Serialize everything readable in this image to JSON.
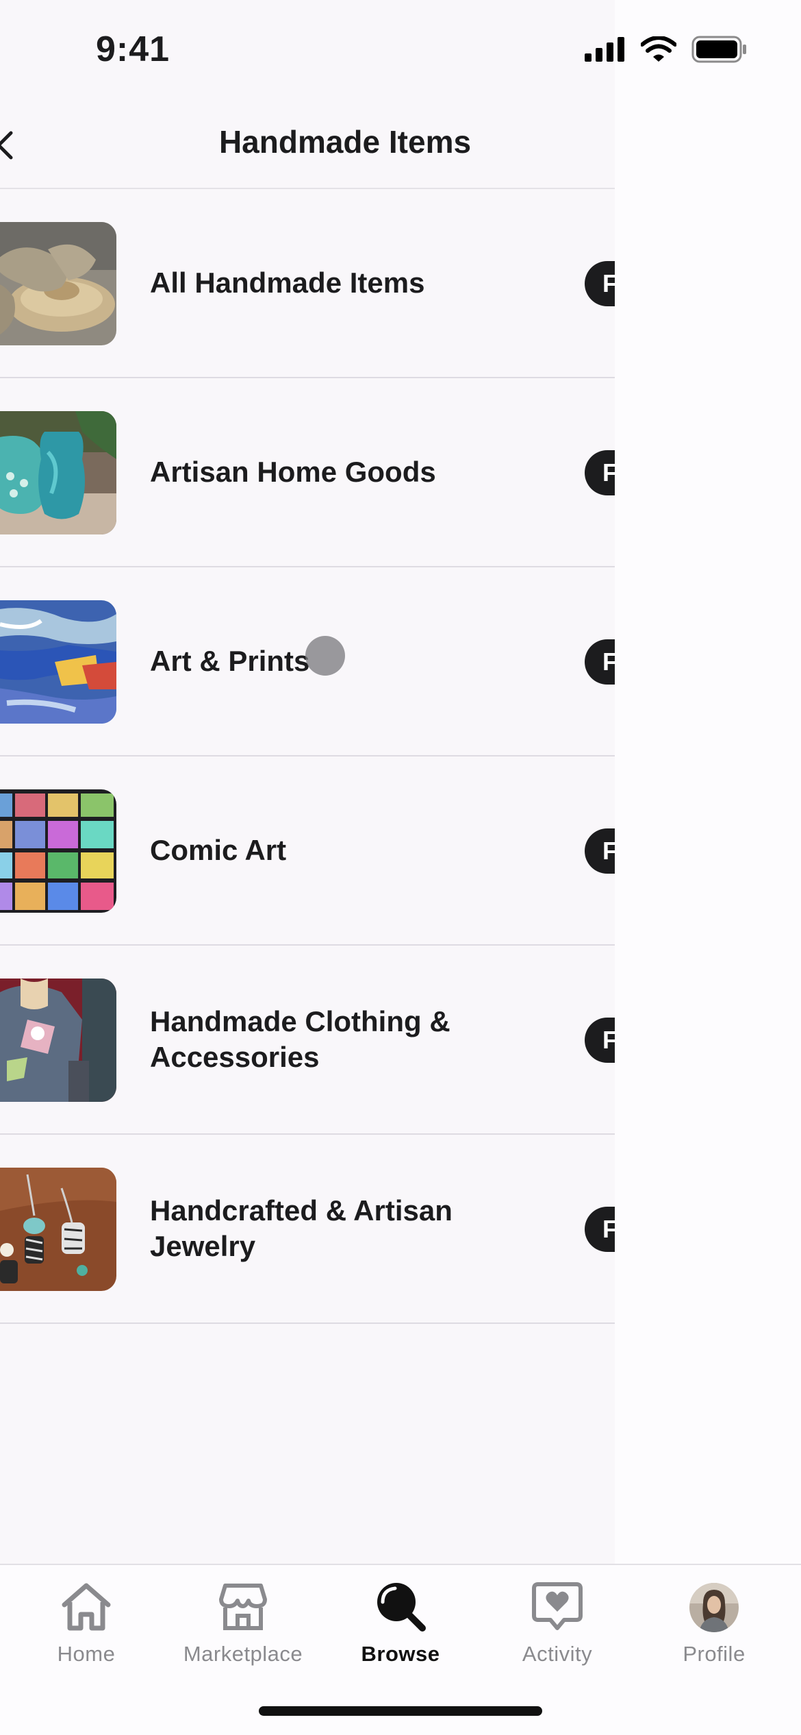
{
  "status_bar": {
    "time": "9:41"
  },
  "header": {
    "title": "Handmade Items"
  },
  "categories": [
    {
      "label": "All Handmade Items",
      "button": "F",
      "thumb": "pottery-wheel-image"
    },
    {
      "label": "Artisan Home Goods",
      "button": "F",
      "thumb": "ceramic-vases-image"
    },
    {
      "label": "Art & Prints",
      "button": "F",
      "thumb": "abstract-painting-image"
    },
    {
      "label": "Comic Art",
      "button": "F",
      "thumb": "comic-panels-image"
    },
    {
      "label": "Handmade Clothing & Accessories",
      "button": "F",
      "thumb": "sweater-image"
    },
    {
      "label": "Handcrafted & Artisan Jewelry",
      "button": "F",
      "thumb": "jewelry-image"
    }
  ],
  "tab_bar": {
    "tabs": [
      {
        "label": "Home",
        "icon": "house-icon",
        "active": false
      },
      {
        "label": "Marketplace",
        "icon": "storefront-icon",
        "active": false
      },
      {
        "label": "Browse",
        "icon": "magnifier-icon",
        "active": true
      },
      {
        "label": "Activity",
        "icon": "heart-bubble-icon",
        "active": false
      },
      {
        "label": "Profile",
        "icon": "avatar",
        "active": false
      }
    ]
  },
  "colors": {
    "panel_bg": "#f9f7fa",
    "text": "#1c1c1e",
    "inactive_tab": "#8a8a8e",
    "pill": "#1c1c1e"
  }
}
